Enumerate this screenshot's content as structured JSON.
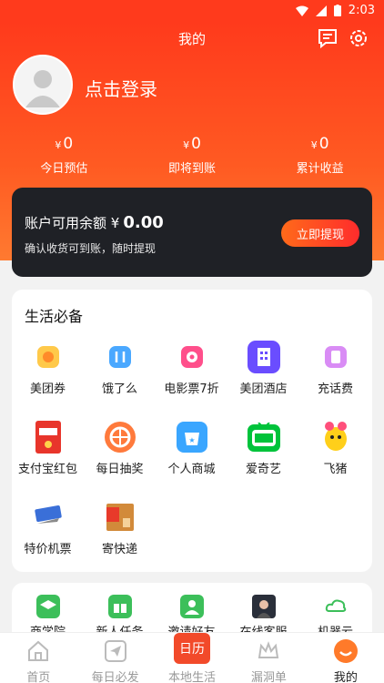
{
  "status_bar": {
    "time": "2:03"
  },
  "header": {
    "title": "我的",
    "login_label": "点击登录",
    "currency": "¥",
    "stats": [
      {
        "value": "0",
        "label": "今日预估"
      },
      {
        "value": "0",
        "label": "即将到账"
      },
      {
        "value": "0",
        "label": "累计收益"
      }
    ]
  },
  "balance": {
    "title": "账户可用余额",
    "currency": "¥",
    "amount": "0.00",
    "subtitle": "确认收货可到账，随时提现",
    "withdraw_label": "立即提现"
  },
  "life": {
    "title": "生活必备",
    "items": [
      {
        "label": "美团券",
        "icon": "meituan-coupon-icon"
      },
      {
        "label": "饿了么",
        "icon": "eleme-icon"
      },
      {
        "label": "电影票7折",
        "icon": "movie-ticket-icon"
      },
      {
        "label": "美团酒店",
        "icon": "hotel-icon"
      },
      {
        "label": "充话费",
        "icon": "phone-recharge-icon"
      },
      {
        "label": "支付宝红包",
        "icon": "alipay-redpacket-icon"
      },
      {
        "label": "每日抽奖",
        "icon": "lottery-icon"
      },
      {
        "label": "个人商城",
        "icon": "shop-icon"
      },
      {
        "label": "爱奇艺",
        "icon": "iqiyi-icon"
      },
      {
        "label": "飞猪",
        "icon": "fliggy-icon"
      },
      {
        "label": "特价机票",
        "icon": "flight-ticket-icon"
      },
      {
        "label": "寄快递",
        "icon": "express-icon"
      }
    ]
  },
  "tools": {
    "items": [
      {
        "label": "商学院",
        "icon": "academy-icon"
      },
      {
        "label": "新人任务",
        "icon": "gift-icon"
      },
      {
        "label": "邀请好友",
        "icon": "invite-icon"
      },
      {
        "label": "在线客服",
        "icon": "service-avatar-icon"
      },
      {
        "label": "机器云",
        "icon": "cloud-icon"
      }
    ]
  },
  "tabbar": {
    "items": [
      {
        "label": "首页",
        "icon": "home-icon"
      },
      {
        "label": "每日必发",
        "icon": "send-icon"
      },
      {
        "label": "本地生活",
        "icon": "calendar-icon",
        "badge": "日历"
      },
      {
        "label": "漏洞单",
        "icon": "crown-icon"
      },
      {
        "label": "我的",
        "icon": "smile-icon"
      }
    ],
    "active": "我的"
  },
  "colors": {
    "accent": "#ff3a1c",
    "dark_card": "#1f2126"
  }
}
